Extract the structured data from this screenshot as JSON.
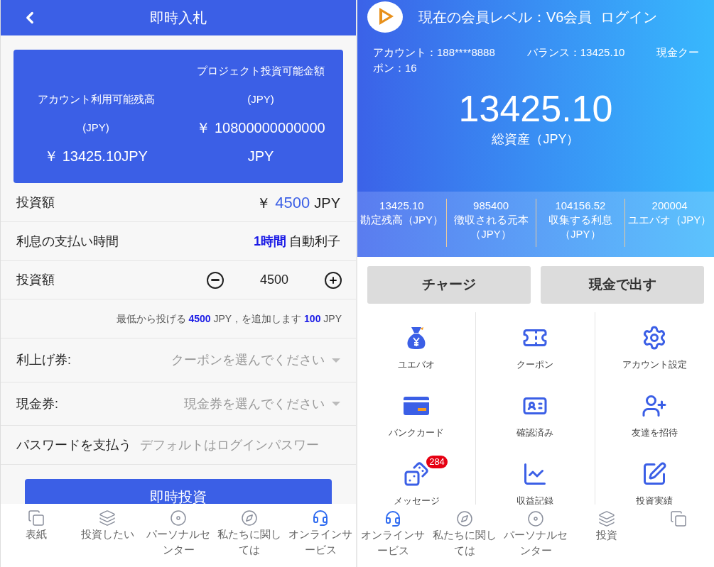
{
  "left": {
    "header": {
      "title": "即時入札"
    },
    "balance_card": {
      "left_label": "アカウント利用可能残高",
      "left_unit": "(JPY)",
      "left_value": "￥ 13425.10JPY",
      "right_label": "プロジェクト投資可能金額",
      "right_unit": "(JPY)",
      "right_value": "￥ 10800000000000",
      "right_suffix": "JPY"
    },
    "rows": [
      {
        "kind": "amount",
        "label": "投資額",
        "currency": "￥",
        "value": "4500",
        "unit": "JPY"
      },
      {
        "kind": "interval",
        "label": "利息の支払い時間",
        "value": "1時間",
        "suffix": "自動利子"
      },
      {
        "kind": "stepper",
        "label": "投資額",
        "value": "4500"
      },
      {
        "kind": "hint",
        "text": "最低から投げる **4500** JPY，を追加します **100** JPY"
      },
      {
        "kind": "select",
        "label": "利上げ券:",
        "placeholder": "クーポンを選んでください"
      },
      {
        "kind": "select",
        "label": "現金券:",
        "placeholder": "現金券を選んでください"
      },
      {
        "kind": "password",
        "label": "パスワードを支払う",
        "placeholder": "デフォルトはログインパスワー"
      }
    ],
    "submit": "即時投資",
    "nav": [
      {
        "kind": "cover",
        "label": "表紙"
      },
      {
        "kind": "invest",
        "label": "投資したい"
      },
      {
        "kind": "personal",
        "label": "パーソナルセンター"
      },
      {
        "kind": "about",
        "label": "私たちに関しては"
      },
      {
        "kind": "service",
        "label": "オンラインサービス"
      }
    ]
  },
  "right": {
    "header": {
      "level": "現在の会員レベル：V6会員",
      "login": "ログイン"
    },
    "info": [
      "アカウント：188****8888",
      "バランス：13425.10",
      "現金クーポン：16"
    ],
    "total": {
      "value": "13425.10",
      "label": "総資産（JPY）"
    },
    "stats": [
      {
        "value": "13425.10",
        "label": "勘定残高（JPY）"
      },
      {
        "value": "985400",
        "label": "徴収される元本（JPY）"
      },
      {
        "value": "104156.52",
        "label": "収集する利息（JPY）"
      },
      {
        "value": "200004",
        "label": "ユエバオ（JPY）"
      }
    ],
    "buttons": [
      "チャージ",
      "現金で出す"
    ],
    "menu": [
      {
        "kind": "bag",
        "label": "ユエバオ"
      },
      {
        "kind": "ticket",
        "label": "クーポン"
      },
      {
        "kind": "settings",
        "label": "アカウント設定"
      },
      {
        "kind": "card",
        "label": "バンクカード"
      },
      {
        "kind": "idcard",
        "label": "確認済み"
      },
      {
        "kind": "invite",
        "label": "友達を招待"
      },
      {
        "kind": "dice",
        "label": "メッセージ",
        "badge": "284"
      },
      {
        "kind": "chart",
        "label": "収益記録"
      },
      {
        "kind": "pen",
        "label": "投資実績"
      }
    ],
    "nav": [
      {
        "kind": "service",
        "label": "オンラインサービス"
      },
      {
        "kind": "about",
        "label": "私たちに関しては"
      },
      {
        "kind": "personal",
        "label": "パーソナルセンター"
      },
      {
        "kind": "invest",
        "label": "投資"
      },
      {
        "kind": "cover"
      }
    ]
  }
}
